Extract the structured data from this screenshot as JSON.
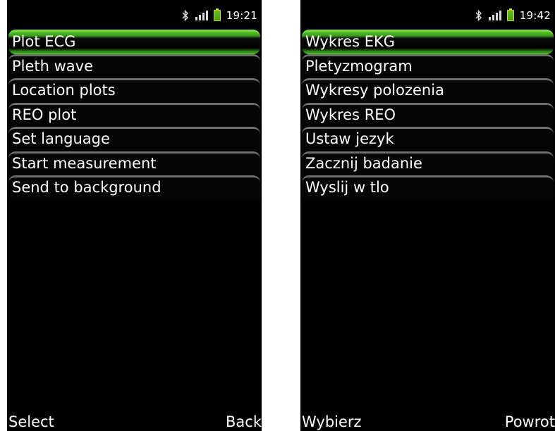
{
  "left_screen": {
    "status": {
      "time": "19:21"
    },
    "menu": [
      {
        "label": "Plot ECG",
        "selected": true
      },
      {
        "label": "Pleth wave"
      },
      {
        "label": "Location plots"
      },
      {
        "label": "REO plot"
      },
      {
        "label": "Set language"
      },
      {
        "label": "Start measurement"
      },
      {
        "label": "Send to background"
      }
    ],
    "softkeys": {
      "left": "Select",
      "right": "Back"
    }
  },
  "right_screen": {
    "status": {
      "time": "19:42"
    },
    "menu": [
      {
        "label": "Wykres EKG",
        "selected": true
      },
      {
        "label": "Pletyzmogram"
      },
      {
        "label": "Wykresy polozenia"
      },
      {
        "label": "Wykres REO"
      },
      {
        "label": "Ustaw jezyk"
      },
      {
        "label": "Zacznij badanie"
      },
      {
        "label": "Wyslij w tlo"
      }
    ],
    "softkeys": {
      "left": "Wybierz",
      "right": "Powrot"
    }
  },
  "colors": {
    "screen_background": "#000000",
    "selection_accent": "#58c22c",
    "item_border": "#6f6f6f",
    "battery": "#45a014"
  },
  "icons": [
    "bluetooth-icon",
    "signal-strength-icon",
    "battery-icon"
  ]
}
